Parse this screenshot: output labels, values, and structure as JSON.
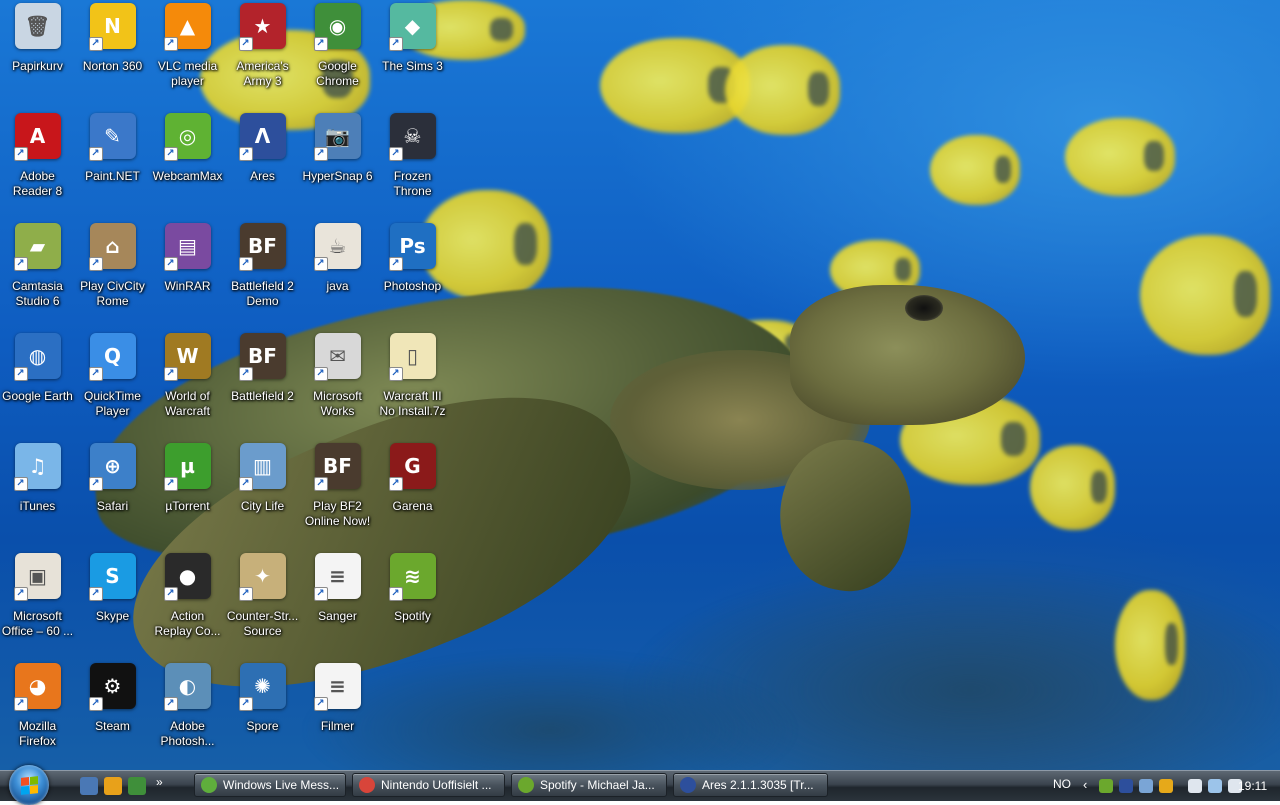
{
  "desktop": {
    "icons": [
      {
        "label": "Papirkurv",
        "icon": "recycle-bin-icon",
        "color": "#c9d6e3",
        "glyph": "🗑"
      },
      {
        "label": "Norton 360",
        "icon": "norton-360-icon",
        "color": "#f2c318",
        "glyph": "N"
      },
      {
        "label": "VLC media\nplayer",
        "icon": "vlc-icon",
        "color": "#f58a0a",
        "glyph": "▲"
      },
      {
        "label": "America's\nArmy 3",
        "icon": "americas-army-icon",
        "color": "#b3232b",
        "glyph": "★"
      },
      {
        "label": "Google\nChrome",
        "icon": "chrome-icon",
        "color": "#3f8f3a",
        "glyph": "◉"
      },
      {
        "label": "The Sims 3",
        "icon": "sims-icon",
        "color": "#55b9a0",
        "glyph": "◆"
      },
      {
        "label": "Adobe\nReader 8",
        "icon": "adobe-reader-icon",
        "color": "#c8161b",
        "glyph": "A"
      },
      {
        "label": "Paint.NET",
        "icon": "paint-net-icon",
        "color": "#3b78c9",
        "glyph": "✎"
      },
      {
        "label": "WebcamMax",
        "icon": "webcammax-icon",
        "color": "#5fb233",
        "glyph": "◎"
      },
      {
        "label": "Ares",
        "icon": "ares-icon",
        "color": "#2d4f9c",
        "glyph": "Λ"
      },
      {
        "label": "HyperSnap 6",
        "icon": "hypersnap-icon",
        "color": "#4d7fb8",
        "glyph": "📷"
      },
      {
        "label": "Frozen\nThrone",
        "icon": "frozen-throne-icon",
        "color": "#2b2f3a",
        "glyph": "☠"
      },
      {
        "label": "Camtasia\nStudio 6",
        "icon": "camtasia-icon",
        "color": "#8fae4a",
        "glyph": "▰"
      },
      {
        "label": "Play CivCity\nRome",
        "icon": "civcity-icon",
        "color": "#a6875a",
        "glyph": "⌂"
      },
      {
        "label": "WinRAR",
        "icon": "winrar-icon",
        "color": "#7a4aa0",
        "glyph": "▤"
      },
      {
        "label": "Battlefield 2\nDemo",
        "icon": "battlefield-demo-icon",
        "color": "#4a3b2e",
        "glyph": "BF"
      },
      {
        "label": "java",
        "icon": "java-icon",
        "color": "#e9e4da",
        "glyph": "☕"
      },
      {
        "label": "Photoshop",
        "icon": "photoshop-icon",
        "color": "#1f6fc2",
        "glyph": "Ps"
      },
      {
        "label": "Google Earth",
        "icon": "google-earth-icon",
        "color": "#2b6fc3",
        "glyph": "◍"
      },
      {
        "label": "QuickTime\nPlayer",
        "icon": "quicktime-icon",
        "color": "#3a8ee6",
        "glyph": "Q"
      },
      {
        "label": "World of\nWarcraft",
        "icon": "wow-icon",
        "color": "#a07a22",
        "glyph": "W"
      },
      {
        "label": "Battlefield 2",
        "icon": "battlefield-2-icon",
        "color": "#4a3b2e",
        "glyph": "BF"
      },
      {
        "label": "Microsoft\nWorks",
        "icon": "ms-works-icon",
        "color": "#d8d8d8",
        "glyph": "✉"
      },
      {
        "label": "Warcraft III\nNo Install.7z",
        "icon": "archive-file-icon",
        "color": "#f0e6b8",
        "glyph": "▯"
      },
      {
        "label": "iTunes",
        "icon": "itunes-icon",
        "color": "#7ab6e8",
        "glyph": "♫"
      },
      {
        "label": "Safari",
        "icon": "safari-icon",
        "color": "#3d80c9",
        "glyph": "⊕"
      },
      {
        "label": "µTorrent",
        "icon": "utorrent-icon",
        "color": "#3d9e2d",
        "glyph": "µ"
      },
      {
        "label": "City Life",
        "icon": "city-life-icon",
        "color": "#6b9ccc",
        "glyph": "▥"
      },
      {
        "label": "Play BF2\nOnline Now!",
        "icon": "play-bf2-icon",
        "color": "#4a3b2e",
        "glyph": "BF"
      },
      {
        "label": "Garena",
        "icon": "garena-icon",
        "color": "#8b1a1a",
        "glyph": "G"
      },
      {
        "label": "Microsoft\nOffice – 60 ...",
        "icon": "ms-office-icon",
        "color": "#e7e2d8",
        "glyph": "▣"
      },
      {
        "label": "Skype",
        "icon": "skype-icon",
        "color": "#1a9be3",
        "glyph": "S"
      },
      {
        "label": "Action\nReplay Co...",
        "icon": "action-replay-icon",
        "color": "#2a2a2a",
        "glyph": "●"
      },
      {
        "label": "Counter-Str...\nSource",
        "icon": "counter-strike-icon",
        "color": "#c7b07a",
        "glyph": "✦"
      },
      {
        "label": "Sanger",
        "icon": "text-file-icon",
        "color": "#f4f4f4",
        "glyph": "≡"
      },
      {
        "label": "Spotify",
        "icon": "spotify-icon",
        "color": "#6ba82d",
        "glyph": "≋"
      },
      {
        "label": "Mozilla\nFirefox",
        "icon": "firefox-icon",
        "color": "#e8761c",
        "glyph": "◕"
      },
      {
        "label": "Steam",
        "icon": "steam-icon",
        "color": "#111111",
        "glyph": "⚙"
      },
      {
        "label": "Adobe\nPhotosh...",
        "icon": "adobe-photoshop-icon",
        "color": "#5c8fb8",
        "glyph": "◐"
      },
      {
        "label": "Spore",
        "icon": "spore-icon",
        "color": "#2d6fb3",
        "glyph": "✺"
      },
      {
        "label": "Filmer",
        "icon": "text-file-icon",
        "color": "#f4f4f4",
        "glyph": "≡"
      }
    ]
  },
  "taskbar": {
    "start_icon": "windows-start-orb-icon",
    "quick_launch": [
      {
        "icon": "show-desktop-icon",
        "color": "#4a78b5"
      },
      {
        "icon": "media-player-icon",
        "color": "#e8a11a"
      },
      {
        "icon": "chrome-icon",
        "color": "#3f8f3a"
      }
    ],
    "windows": [
      {
        "label": "Windows Live Mess...",
        "icon": "live-messenger-icon",
        "color": "#5fae3c"
      },
      {
        "label": "Nintendo Uoffisielt ...",
        "icon": "chrome-icon",
        "color": "#d8453a"
      },
      {
        "label": "Spotify - Michael Ja...",
        "icon": "spotify-icon",
        "color": "#6ba82d"
      },
      {
        "label": "Ares 2.1.1.3035   [Tr...",
        "icon": "ares-icon",
        "color": "#2d4f9c"
      }
    ],
    "language": "NO",
    "tray_icons": [
      {
        "icon": "spotify-tray-icon",
        "color": "#6ba82d"
      },
      {
        "icon": "ares-tray-icon",
        "color": "#2d4f9c"
      },
      {
        "icon": "network-users-icon",
        "color": "#7aa5d6"
      },
      {
        "icon": "norton-tray-icon",
        "color": "#e6a91a"
      },
      {
        "icon": "device-icon",
        "color": "#dfe6ee"
      },
      {
        "icon": "network-icon",
        "color": "#9cc4ea"
      },
      {
        "icon": "volume-icon",
        "color": "#dfe6ee"
      }
    ],
    "clock": "19:11"
  }
}
